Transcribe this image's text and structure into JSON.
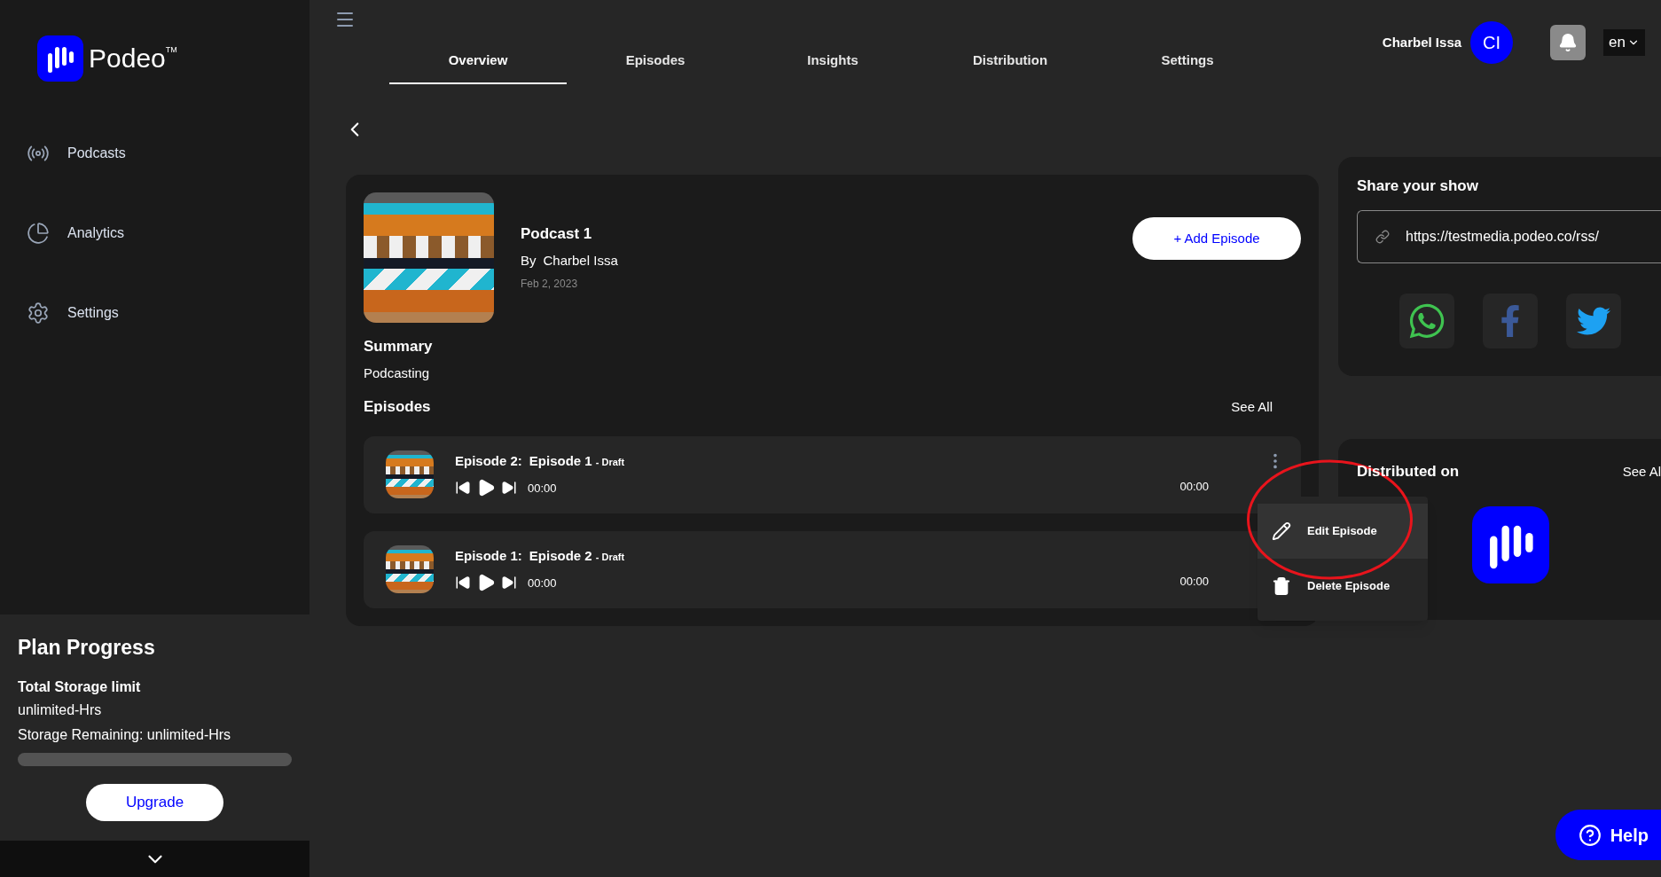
{
  "sidebar": {
    "logo_text": "Podeo",
    "trademark": "TM",
    "nav": [
      {
        "label": "Podcasts",
        "kind": "podcasts"
      },
      {
        "label": "Analytics",
        "kind": "analytics"
      },
      {
        "label": "Settings",
        "kind": "settings"
      }
    ],
    "plan": {
      "title": "Plan Progress",
      "storage_label": "Total Storage limit",
      "storage_value": "unlimited-Hrs",
      "remaining": "Storage Remaining: unlimited-Hrs",
      "level": 0,
      "button": "Upgrade"
    }
  },
  "header": {
    "tabs": [
      {
        "label": "Overview",
        "selected": true
      },
      {
        "label": "Episodes",
        "selected": false
      },
      {
        "label": "Insights",
        "selected": false
      },
      {
        "label": "Distribution",
        "selected": false
      },
      {
        "label": "Settings",
        "selected": false
      }
    ],
    "user_name": "Charbel Issa",
    "avatar_initials": "CI",
    "language": "en"
  },
  "podcast": {
    "title": "Podcast 1",
    "by": "By",
    "author": "Charbel Issa",
    "date": "Feb 2, 2023",
    "add_button": "+ Add Episode",
    "summary_heading": "Summary",
    "summary": "Podcasting",
    "episodes_heading": "Episodes",
    "see_all": "See All",
    "episodes": [
      {
        "number": "Episode 2:",
        "title": "Episode 1",
        "status": "- Draft",
        "elapsed": "00:00",
        "duration": "00:00",
        "menu_open": true
      },
      {
        "number": "Episode 1:",
        "title": "Episode 2",
        "status": "- Draft",
        "elapsed": "00:00",
        "duration": "00:00",
        "menu_open": false
      }
    ]
  },
  "episode_menu": {
    "items": [
      {
        "label": "Edit Episode",
        "kind": "edit",
        "selected": true
      },
      {
        "label": "Delete Episode",
        "kind": "delete",
        "selected": false
      }
    ]
  },
  "share": {
    "title": "Share your show",
    "url": "https://testmedia.podeo.co/rss/",
    "networks": [
      {
        "kind": "whatsapp"
      },
      {
        "kind": "facebook"
      },
      {
        "kind": "twitter"
      }
    ]
  },
  "distributed": {
    "title": "Distributed on",
    "see_all": "See Al",
    "platforms": [
      {
        "kind": "podeo"
      }
    ]
  },
  "help": "Help"
}
